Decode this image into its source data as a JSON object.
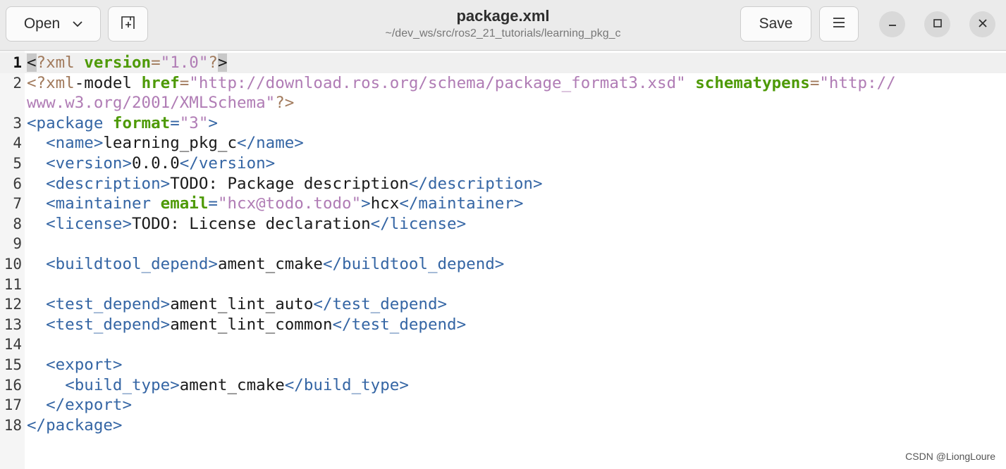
{
  "window": {
    "title": "package.xml",
    "subtitle": "~/dev_ws/src/ros2_21_tutorials/learning_pkg_c"
  },
  "toolbar": {
    "open_label": "Open",
    "save_label": "Save"
  },
  "icons": {
    "open_dropdown": "chevron-down-icon",
    "new_tab": "new-tab-icon",
    "menu": "hamburger-menu-icon",
    "minimize": "minimize-icon",
    "maximize": "maximize-icon",
    "close": "close-icon"
  },
  "colors": {
    "tag": "#3465a4",
    "attribute": "#4e9a06",
    "string": "#b07cb5",
    "processing_instruction": "#a17a5c",
    "text": "#1a1a1a"
  },
  "editor": {
    "current_line": 1,
    "lines": [
      {
        "n": "1",
        "t": [
          [
            "sel",
            "<"
          ],
          [
            "pi",
            "?xml "
          ],
          [
            "attr",
            "version"
          ],
          [
            "pi",
            "="
          ],
          [
            "str",
            "\"1.0\""
          ],
          [
            "pi",
            "?"
          ],
          [
            "sel",
            ">"
          ]
        ]
      },
      {
        "n": "2",
        "t": [
          [
            "pi",
            "<?xml"
          ],
          [
            "text",
            "-model "
          ],
          [
            "attr",
            "href"
          ],
          [
            "pi",
            "="
          ],
          [
            "str",
            "\"http://download.ros.org/schema/package_format3.xsd\""
          ],
          [
            "text",
            " "
          ],
          [
            "attr",
            "schematypens"
          ],
          [
            "pi",
            "="
          ],
          [
            "str",
            "\"http://"
          ]
        ]
      },
      {
        "n": "",
        "t": [
          [
            "str",
            "www.w3.org/2001/XMLSchema\""
          ],
          [
            "pi",
            "?>"
          ]
        ]
      },
      {
        "n": "3",
        "t": [
          [
            "tag",
            "<package "
          ],
          [
            "attr",
            "format"
          ],
          [
            "tag",
            "="
          ],
          [
            "str",
            "\"3\""
          ],
          [
            "tag",
            ">"
          ]
        ]
      },
      {
        "n": "4",
        "t": [
          [
            "text",
            "  "
          ],
          [
            "tag",
            "<name>"
          ],
          [
            "text",
            "learning_pkg_c"
          ],
          [
            "tag",
            "</name>"
          ]
        ]
      },
      {
        "n": "5",
        "t": [
          [
            "text",
            "  "
          ],
          [
            "tag",
            "<version>"
          ],
          [
            "text",
            "0.0.0"
          ],
          [
            "tag",
            "</version>"
          ]
        ]
      },
      {
        "n": "6",
        "t": [
          [
            "text",
            "  "
          ],
          [
            "tag",
            "<description>"
          ],
          [
            "text",
            "TODO: Package description"
          ],
          [
            "tag",
            "</description>"
          ]
        ]
      },
      {
        "n": "7",
        "t": [
          [
            "text",
            "  "
          ],
          [
            "tag",
            "<maintainer "
          ],
          [
            "attr",
            "email"
          ],
          [
            "tag",
            "="
          ],
          [
            "str",
            "\"hcx@todo.todo\""
          ],
          [
            "tag",
            ">"
          ],
          [
            "text",
            "hcx"
          ],
          [
            "tag",
            "</maintainer>"
          ]
        ]
      },
      {
        "n": "8",
        "t": [
          [
            "text",
            "  "
          ],
          [
            "tag",
            "<license>"
          ],
          [
            "text",
            "TODO: License declaration"
          ],
          [
            "tag",
            "</license>"
          ]
        ]
      },
      {
        "n": "9",
        "t": []
      },
      {
        "n": "10",
        "t": [
          [
            "text",
            "  "
          ],
          [
            "tag",
            "<buildtool_depend>"
          ],
          [
            "text",
            "ament_cmake"
          ],
          [
            "tag",
            "</buildtool_depend>"
          ]
        ]
      },
      {
        "n": "11",
        "t": []
      },
      {
        "n": "12",
        "t": [
          [
            "text",
            "  "
          ],
          [
            "tag",
            "<test_depend>"
          ],
          [
            "text",
            "ament_lint_auto"
          ],
          [
            "tag",
            "</test_depend>"
          ]
        ]
      },
      {
        "n": "13",
        "t": [
          [
            "text",
            "  "
          ],
          [
            "tag",
            "<test_depend>"
          ],
          [
            "text",
            "ament_lint_common"
          ],
          [
            "tag",
            "</test_depend>"
          ]
        ]
      },
      {
        "n": "14",
        "t": []
      },
      {
        "n": "15",
        "t": [
          [
            "text",
            "  "
          ],
          [
            "tag",
            "<export>"
          ]
        ]
      },
      {
        "n": "16",
        "t": [
          [
            "text",
            "    "
          ],
          [
            "tag",
            "<build_type>"
          ],
          [
            "text",
            "ament_cmake"
          ],
          [
            "tag",
            "</build_type>"
          ]
        ]
      },
      {
        "n": "17",
        "t": [
          [
            "text",
            "  "
          ],
          [
            "tag",
            "</export>"
          ]
        ]
      },
      {
        "n": "18",
        "t": [
          [
            "tag",
            "</package>"
          ]
        ]
      }
    ]
  },
  "watermark": "CSDN @LiongLoure"
}
